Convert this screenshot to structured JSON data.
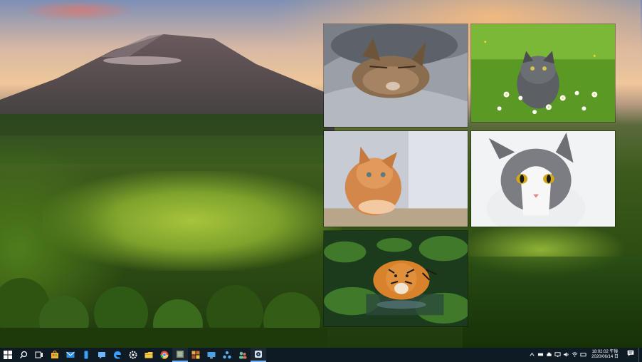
{
  "taskbar": {
    "apps": [
      {
        "name": "start-icon",
        "color": "#ffffff"
      },
      {
        "name": "search-icon",
        "color": "#ffffff"
      },
      {
        "name": "task-view-icon",
        "color": "#ffffff"
      },
      {
        "name": "store-icon",
        "color": "#f3b32a"
      },
      {
        "name": "mail-icon",
        "color": "#2d8de0"
      },
      {
        "name": "phone-icon",
        "color": "#3aa0ff"
      },
      {
        "name": "messaging-icon",
        "color": "#6cb6ff"
      },
      {
        "name": "edge-icon",
        "color": "#3aa0ff"
      },
      {
        "name": "settings-icon",
        "color": "#ffffff"
      },
      {
        "name": "file-explorer-icon",
        "color": "#f7c948"
      },
      {
        "name": "chrome-icon",
        "color": "#e3503f"
      },
      {
        "name": "photo-app-icon",
        "color": "#7c8c76"
      },
      {
        "name": "collage-app-icon",
        "color": "#e7a93b"
      },
      {
        "name": "remote-desktop-icon",
        "color": "#4aa3e8"
      },
      {
        "name": "network-app-icon",
        "color": "#5ab0f0"
      },
      {
        "name": "people-app-icon",
        "color": "#6ac0a0"
      },
      {
        "name": "camera-app-icon",
        "color": "#d9e4f0"
      }
    ],
    "tray_icons": [
      "chevron-up-icon",
      "network-device-icon",
      "printer-icon",
      "display-icon",
      "volume-icon",
      "wifi-icon",
      "keyboard-icon"
    ],
    "clock": {
      "time": "18:02:02 午後",
      "date": "2020/06/14 日"
    },
    "notification_icon": "notification-icon"
  }
}
